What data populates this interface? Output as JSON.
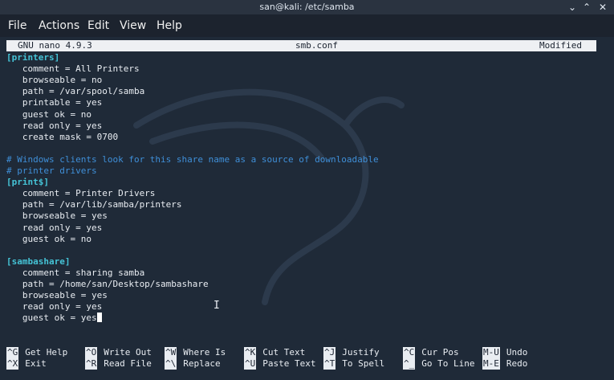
{
  "window": {
    "title": "san@kali: /etc/samba",
    "minimize_icon": "minimize-icon",
    "maximize_icon": "maximize-icon",
    "close_icon": "close-icon"
  },
  "menubar": {
    "items": [
      "File",
      "Actions",
      "Edit",
      "View",
      "Help"
    ]
  },
  "nano": {
    "version": "GNU nano 4.9.3",
    "filename": "smb.conf",
    "status": "Modified"
  },
  "editor": {
    "lines": [
      {
        "type": "section",
        "text": "[printers]"
      },
      {
        "type": "normal",
        "text": "   comment = All Printers"
      },
      {
        "type": "normal",
        "text": "   browseable = no"
      },
      {
        "type": "normal",
        "text": "   path = /var/spool/samba"
      },
      {
        "type": "normal",
        "text": "   printable = yes"
      },
      {
        "type": "normal",
        "text": "   guest ok = no"
      },
      {
        "type": "normal",
        "text": "   read only = yes"
      },
      {
        "type": "normal",
        "text": "   create mask = 0700"
      },
      {
        "type": "blank",
        "text": ""
      },
      {
        "type": "comment",
        "text": "# Windows clients look for this share name as a source of downloadable"
      },
      {
        "type": "comment",
        "text": "# printer drivers"
      },
      {
        "type": "section",
        "text": "[print$]"
      },
      {
        "type": "normal",
        "text": "   comment = Printer Drivers"
      },
      {
        "type": "normal",
        "text": "   path = /var/lib/samba/printers"
      },
      {
        "type": "normal",
        "text": "   browseable = yes"
      },
      {
        "type": "normal",
        "text": "   read only = yes"
      },
      {
        "type": "normal",
        "text": "   guest ok = no"
      },
      {
        "type": "blank",
        "text": ""
      },
      {
        "type": "section",
        "text": "[sambashare]"
      },
      {
        "type": "normal",
        "text": "   comment = sharing samba"
      },
      {
        "type": "normal",
        "text": "   path = /home/san/Desktop/sambashare"
      },
      {
        "type": "normal",
        "text": "   browseable = yes"
      },
      {
        "type": "normal",
        "text": "   read only = yes"
      },
      {
        "type": "normal",
        "text": "   guest ok = yes",
        "cursor": true
      }
    ]
  },
  "shortcuts": [
    {
      "key": "^G",
      "label": "Get Help"
    },
    {
      "key": "^O",
      "label": "Write Out"
    },
    {
      "key": "^W",
      "label": "Where Is"
    },
    {
      "key": "^K",
      "label": "Cut Text"
    },
    {
      "key": "^J",
      "label": "Justify"
    },
    {
      "key": "^C",
      "label": "Cur Pos"
    },
    {
      "key": "M-U",
      "label": "Undo"
    },
    {
      "key": "^X",
      "label": "Exit"
    },
    {
      "key": "^R",
      "label": "Read File"
    },
    {
      "key": "^\\",
      "label": "Replace"
    },
    {
      "key": "^U",
      "label": "Paste Text"
    },
    {
      "key": "^T",
      "label": "To Spell"
    },
    {
      "key": "^_",
      "label": "Go To Line"
    },
    {
      "key": "M-E",
      "label": "Redo"
    }
  ],
  "colors": {
    "background": "#1f2a38",
    "section": "#45c3d6",
    "comment": "#3f8fd8",
    "text": "#e9edf2",
    "nanobar_bg": "#eef0f3"
  }
}
